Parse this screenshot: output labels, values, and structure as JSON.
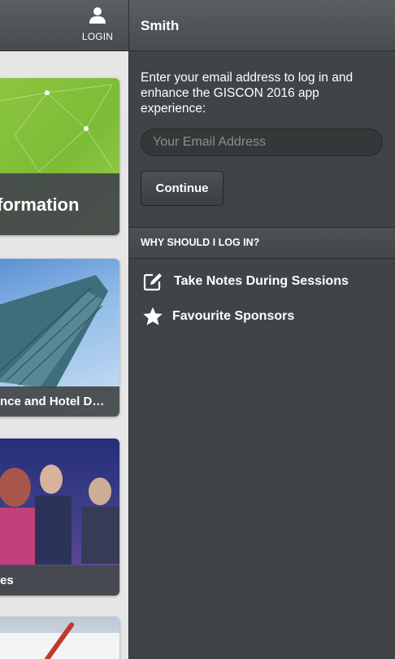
{
  "header": {
    "login_label": "LOGIN",
    "panel_title": "Smith"
  },
  "cards": [
    {
      "label": "formation"
    },
    {
      "label": "nce and Hotel D…"
    },
    {
      "label": "es"
    }
  ],
  "login": {
    "intro_text": "Enter your email address to log in and enhance the GISCON 2016 app experience:",
    "email_placeholder": "Your Email Address",
    "email_value": "",
    "continue_label": "Continue"
  },
  "why": {
    "title": "WHY SHOULD I LOG IN?",
    "items": [
      {
        "label": "Take Notes During Sessions",
        "icon": "edit-note-icon"
      },
      {
        "label": "Favourite Sponsors",
        "icon": "star-icon"
      }
    ]
  },
  "colors": {
    "panel_bg": "#404446",
    "header_bg": "#50555"
  }
}
